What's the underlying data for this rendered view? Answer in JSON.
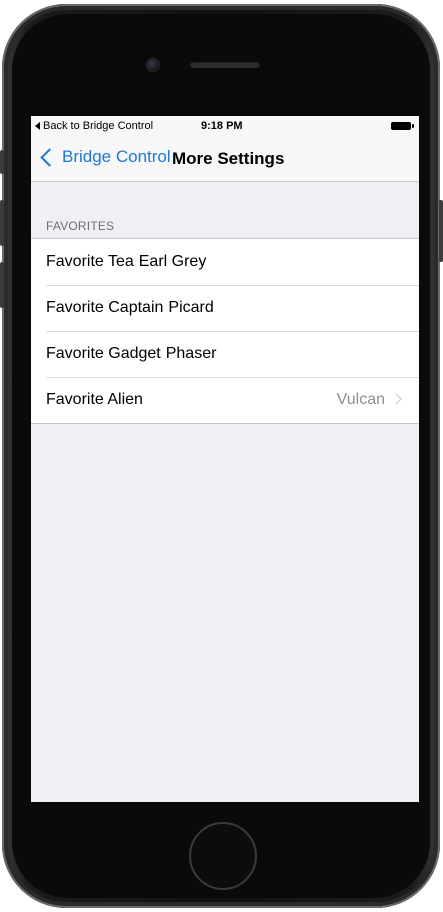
{
  "status_bar": {
    "back_label": "Back to Bridge Control",
    "time": "9:18 PM",
    "battery_icon": "battery-icon"
  },
  "nav": {
    "back_label": "Bridge Control",
    "back_icon": "chevron-left-icon",
    "title": "More Settings"
  },
  "favorites": {
    "header": "FAVORITES",
    "rows": [
      {
        "label": "Favorite Tea",
        "value": "Earl Grey"
      },
      {
        "label": "Favorite Captain",
        "value": "Picard"
      },
      {
        "label": "Favorite Gadget",
        "value": "Phaser"
      },
      {
        "label": "Favorite Alien",
        "detail": "Vulcan",
        "icon": "chevron-right-icon"
      }
    ]
  },
  "colors": {
    "tint": "#1a7ae0",
    "background": "#efeff4",
    "separator": "#c8c7cc",
    "detail_text": "#8e8e93"
  }
}
